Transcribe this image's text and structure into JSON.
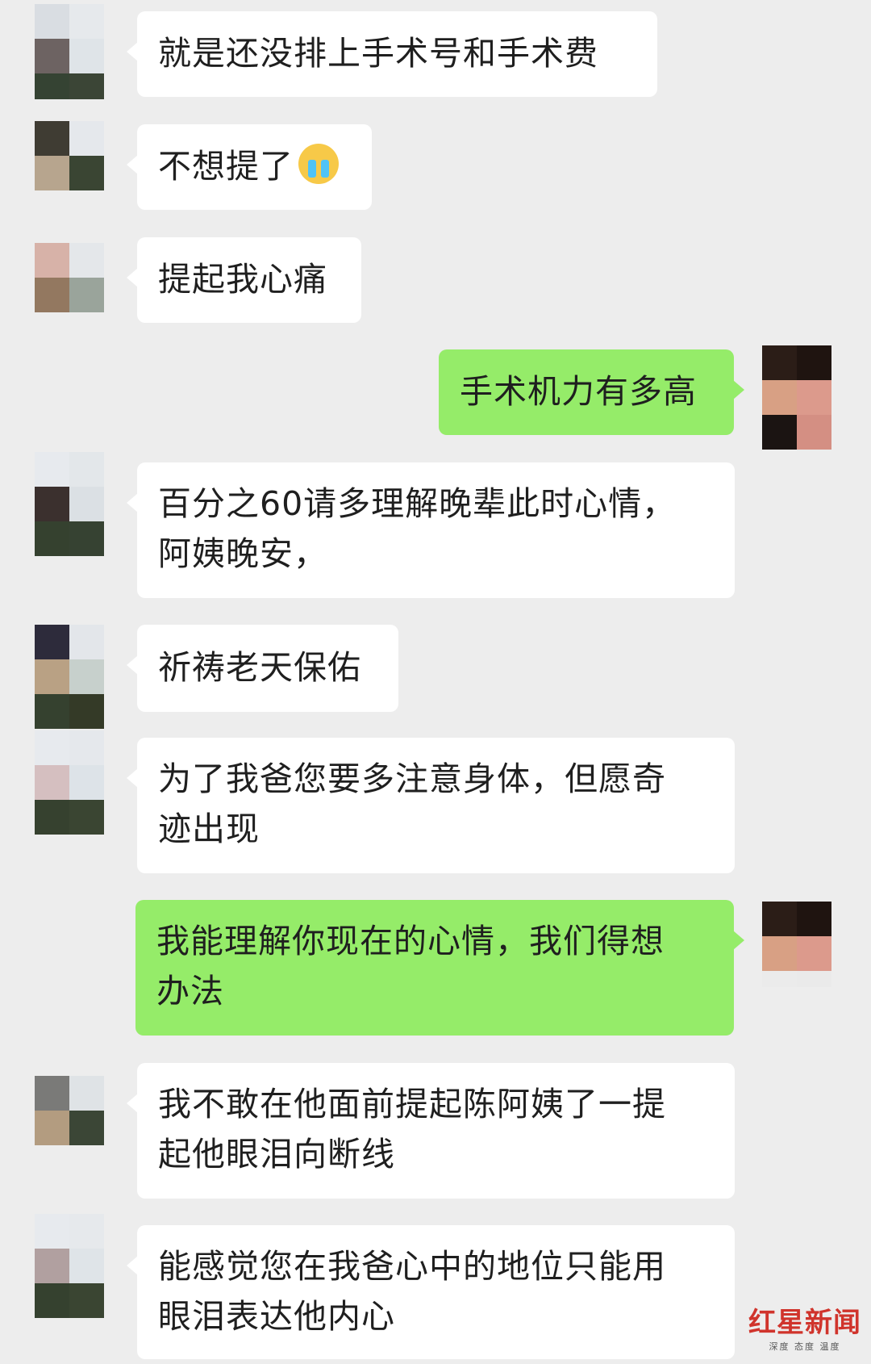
{
  "messages": [
    {
      "side": "left",
      "lines": [
        "就是还没排上手术号和手术费"
      ]
    },
    {
      "side": "left",
      "lines": [
        "不想提了"
      ],
      "emoji": "crying-emoji"
    },
    {
      "side": "left",
      "lines": [
        "提起我心痛"
      ]
    },
    {
      "side": "right",
      "lines": [
        "手术机力有多高"
      ]
    },
    {
      "side": "left",
      "lines": [
        "百分之60请多理解晚辈此时心情，",
        "阿姨晚安，"
      ]
    },
    {
      "side": "left",
      "lines": [
        "祈祷老天保佑"
      ]
    },
    {
      "side": "left",
      "lines": [
        "为了我爸您要多注意身体，但愿奇",
        "迹出现"
      ]
    },
    {
      "side": "right",
      "lines": [
        "我能理解你现在的心情，我们得想",
        "办法"
      ]
    },
    {
      "side": "left",
      "lines": [
        "我不敢在他面前提起陈阿姨了一提",
        "起他眼泪向断线"
      ]
    },
    {
      "side": "left",
      "lines": [
        "能感觉您在我爸心中的地位只能用",
        "眼泪表达他内心"
      ]
    }
  ],
  "watermark": {
    "title": "红星新闻",
    "subtitle": "深度 态度 温度"
  },
  "colors": {
    "background": "#ededed",
    "bubble_in": "#ffffff",
    "bubble_out": "#95ec69"
  }
}
